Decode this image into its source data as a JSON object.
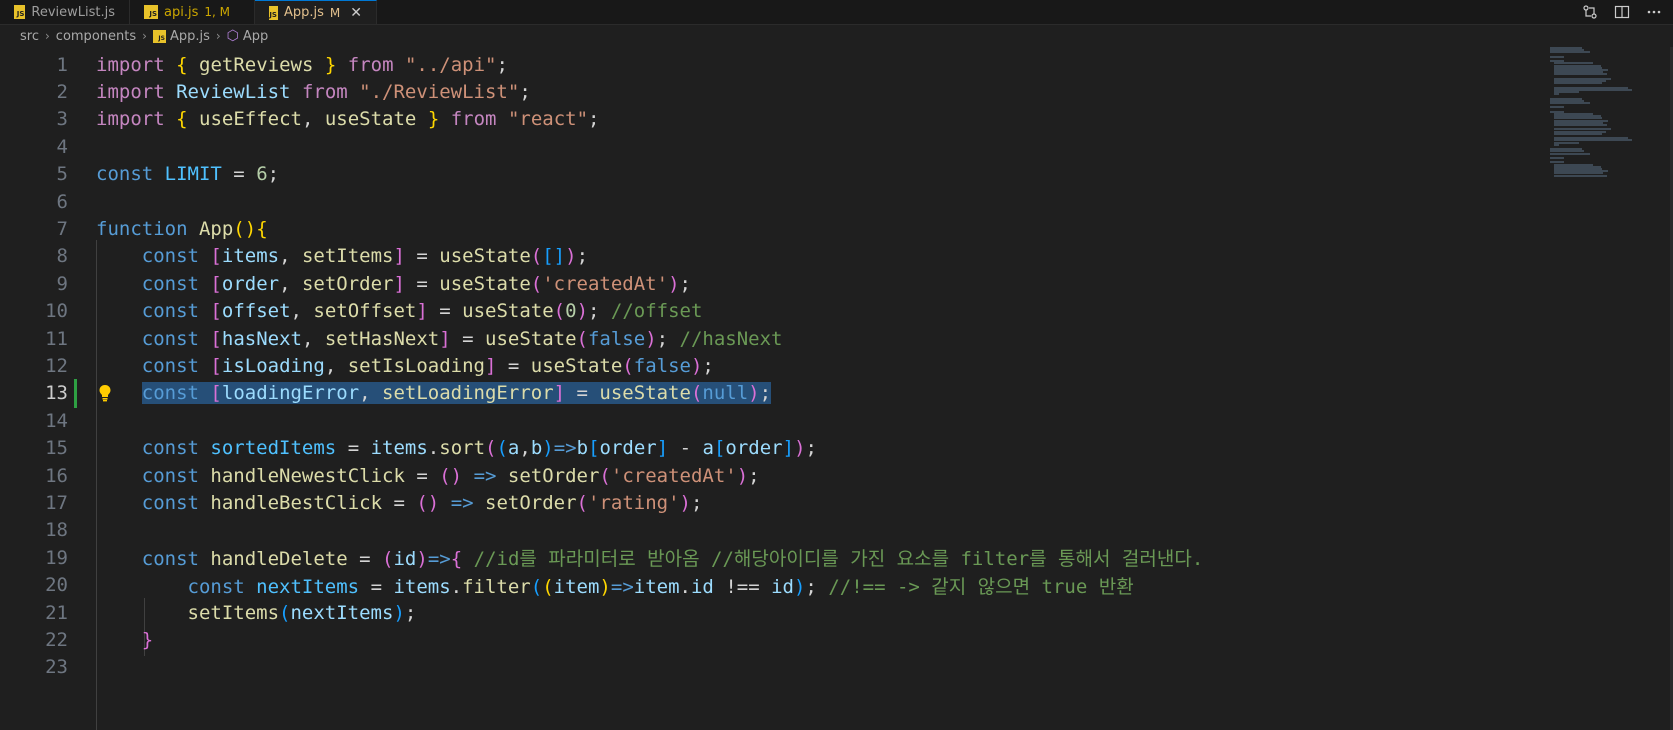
{
  "tabs": [
    {
      "label": "ReviewList.js",
      "status": "",
      "active": false
    },
    {
      "label": "api.js",
      "status": "1, M",
      "active": false
    },
    {
      "label": "App.js",
      "status": "M",
      "active": true
    }
  ],
  "breadcrumb": {
    "folder1": "src",
    "folder2": "components",
    "file": "App.js",
    "symbol": "App"
  },
  "editor": {
    "current_line": 13,
    "line_numbers": [
      "1",
      "2",
      "3",
      "4",
      "5",
      "6",
      "7",
      "8",
      "9",
      "10",
      "11",
      "12",
      "13",
      "14",
      "15",
      "16",
      "17",
      "18",
      "19",
      "20",
      "21",
      "22",
      "23"
    ],
    "lines": [
      [
        [
          "kw",
          "import"
        ],
        [
          "p",
          " "
        ],
        [
          "b1",
          "{"
        ],
        [
          "p",
          " "
        ],
        [
          "fn",
          "getReviews"
        ],
        [
          "p",
          " "
        ],
        [
          "b1",
          "}"
        ],
        [
          "p",
          " "
        ],
        [
          "kw",
          "from"
        ],
        [
          "p",
          " "
        ],
        [
          "s",
          "\"../api\""
        ],
        [
          "p",
          ";"
        ]
      ],
      [
        [
          "kw",
          "import"
        ],
        [
          "p",
          " "
        ],
        [
          "v",
          "ReviewList"
        ],
        [
          "p",
          " "
        ],
        [
          "kw",
          "from"
        ],
        [
          "p",
          " "
        ],
        [
          "s",
          "\"./ReviewList\""
        ],
        [
          "p",
          ";"
        ]
      ],
      [
        [
          "kw",
          "import"
        ],
        [
          "p",
          " "
        ],
        [
          "b1",
          "{"
        ],
        [
          "p",
          " "
        ],
        [
          "fn",
          "useEffect"
        ],
        [
          "p",
          ", "
        ],
        [
          "fn",
          "useState"
        ],
        [
          "p",
          " "
        ],
        [
          "b1",
          "}"
        ],
        [
          "p",
          " "
        ],
        [
          "kw",
          "from"
        ],
        [
          "p",
          " "
        ],
        [
          "s",
          "\"react\""
        ],
        [
          "p",
          ";"
        ]
      ],
      [],
      [
        [
          "dc",
          "const"
        ],
        [
          "p",
          " "
        ],
        [
          "cn",
          "LIMIT"
        ],
        [
          "p",
          " = "
        ],
        [
          "n",
          "6"
        ],
        [
          "p",
          ";"
        ]
      ],
      [],
      [
        [
          "dc",
          "function"
        ],
        [
          "p",
          " "
        ],
        [
          "fn",
          "App"
        ],
        [
          "b1",
          "()"
        ],
        [
          "b1",
          "{"
        ]
      ],
      [
        [
          "p",
          "    "
        ],
        [
          "dc",
          "const"
        ],
        [
          "p",
          " "
        ],
        [
          "b2",
          "["
        ],
        [
          "v",
          "items"
        ],
        [
          "p",
          ", "
        ],
        [
          "fn",
          "setItems"
        ],
        [
          "b2",
          "]"
        ],
        [
          "p",
          " = "
        ],
        [
          "fn",
          "useState"
        ],
        [
          "b2",
          "("
        ],
        [
          "b3",
          "[]"
        ],
        [
          "b2",
          ")"
        ],
        [
          "p",
          ";"
        ]
      ],
      [
        [
          "p",
          "    "
        ],
        [
          "dc",
          "const"
        ],
        [
          "p",
          " "
        ],
        [
          "b2",
          "["
        ],
        [
          "v",
          "order"
        ],
        [
          "p",
          ", "
        ],
        [
          "fn",
          "setOrder"
        ],
        [
          "b2",
          "]"
        ],
        [
          "p",
          " = "
        ],
        [
          "fn",
          "useState"
        ],
        [
          "b2",
          "("
        ],
        [
          "s",
          "'createdAt'"
        ],
        [
          "b2",
          ")"
        ],
        [
          "p",
          ";"
        ]
      ],
      [
        [
          "p",
          "    "
        ],
        [
          "dc",
          "const"
        ],
        [
          "p",
          " "
        ],
        [
          "b2",
          "["
        ],
        [
          "v",
          "offset"
        ],
        [
          "p",
          ", "
        ],
        [
          "fn",
          "setOffset"
        ],
        [
          "b2",
          "]"
        ],
        [
          "p",
          " = "
        ],
        [
          "fn",
          "useState"
        ],
        [
          "b2",
          "("
        ],
        [
          "n",
          "0"
        ],
        [
          "b2",
          ")"
        ],
        [
          "p",
          "; "
        ],
        [
          "c",
          "//offset"
        ]
      ],
      [
        [
          "p",
          "    "
        ],
        [
          "dc",
          "const"
        ],
        [
          "p",
          " "
        ],
        [
          "b2",
          "["
        ],
        [
          "v",
          "hasNext"
        ],
        [
          "p",
          ", "
        ],
        [
          "fn",
          "setHasNext"
        ],
        [
          "b2",
          "]"
        ],
        [
          "p",
          " = "
        ],
        [
          "fn",
          "useState"
        ],
        [
          "b2",
          "("
        ],
        [
          "dc",
          "false"
        ],
        [
          "b2",
          ")"
        ],
        [
          "p",
          "; "
        ],
        [
          "c",
          "//hasNext"
        ]
      ],
      [
        [
          "p",
          "    "
        ],
        [
          "dc",
          "const"
        ],
        [
          "p",
          " "
        ],
        [
          "b2",
          "["
        ],
        [
          "v",
          "isLoading"
        ],
        [
          "p",
          ", "
        ],
        [
          "fn",
          "setIsLoading"
        ],
        [
          "b2",
          "]"
        ],
        [
          "p",
          " = "
        ],
        [
          "fn",
          "useState"
        ],
        [
          "b2",
          "("
        ],
        [
          "dc",
          "false"
        ],
        [
          "b2",
          ")"
        ],
        [
          "p",
          ";"
        ]
      ],
      [
        [
          "p",
          "    "
        ],
        [
          "dc",
          "const"
        ],
        [
          "p",
          " "
        ],
        [
          "b2",
          "["
        ],
        [
          "v",
          "loadingError"
        ],
        [
          "p",
          ", "
        ],
        [
          "fn",
          "setLoadingError"
        ],
        [
          "b2",
          "]"
        ],
        [
          "p",
          " = "
        ],
        [
          "fn",
          "useState"
        ],
        [
          "b2",
          "("
        ],
        [
          "dc",
          "null"
        ],
        [
          "b2",
          ")"
        ],
        [
          "p",
          ";"
        ]
      ],
      [],
      [
        [
          "p",
          "    "
        ],
        [
          "dc",
          "const"
        ],
        [
          "p",
          " "
        ],
        [
          "cn",
          "sortedItems"
        ],
        [
          "p",
          " = "
        ],
        [
          "v",
          "items"
        ],
        [
          "p",
          "."
        ],
        [
          "fn",
          "sort"
        ],
        [
          "b2",
          "("
        ],
        [
          "b3",
          "("
        ],
        [
          "v",
          "a"
        ],
        [
          "p",
          ","
        ],
        [
          "v",
          "b"
        ],
        [
          "b3",
          ")"
        ],
        [
          "dc",
          "=>"
        ],
        [
          "v",
          "b"
        ],
        [
          "b3",
          "["
        ],
        [
          "v",
          "order"
        ],
        [
          "b3",
          "]"
        ],
        [
          "p",
          " - "
        ],
        [
          "v",
          "a"
        ],
        [
          "b3",
          "["
        ],
        [
          "v",
          "order"
        ],
        [
          "b3",
          "]"
        ],
        [
          "b2",
          ")"
        ],
        [
          "p",
          ";"
        ]
      ],
      [
        [
          "p",
          "    "
        ],
        [
          "dc",
          "const"
        ],
        [
          "p",
          " "
        ],
        [
          "fn",
          "handleNewestClick"
        ],
        [
          "p",
          " = "
        ],
        [
          "b2",
          "()"
        ],
        [
          "p",
          " "
        ],
        [
          "dc",
          "=>"
        ],
        [
          "p",
          " "
        ],
        [
          "fn",
          "setOrder"
        ],
        [
          "b2",
          "("
        ],
        [
          "s",
          "'createdAt'"
        ],
        [
          "b2",
          ")"
        ],
        [
          "p",
          ";"
        ]
      ],
      [
        [
          "p",
          "    "
        ],
        [
          "dc",
          "const"
        ],
        [
          "p",
          " "
        ],
        [
          "fn",
          "handleBestClick"
        ],
        [
          "p",
          " = "
        ],
        [
          "b2",
          "()"
        ],
        [
          "p",
          " "
        ],
        [
          "dc",
          "=>"
        ],
        [
          "p",
          " "
        ],
        [
          "fn",
          "setOrder"
        ],
        [
          "b2",
          "("
        ],
        [
          "s",
          "'rating'"
        ],
        [
          "b2",
          ")"
        ],
        [
          "p",
          ";"
        ]
      ],
      [],
      [
        [
          "p",
          "    "
        ],
        [
          "dc",
          "const"
        ],
        [
          "p",
          " "
        ],
        [
          "fn",
          "handleDelete"
        ],
        [
          "p",
          " = "
        ],
        [
          "b2",
          "("
        ],
        [
          "v",
          "id"
        ],
        [
          "b2",
          ")"
        ],
        [
          "dc",
          "=>"
        ],
        [
          "b2",
          "{"
        ],
        [
          "p",
          " "
        ],
        [
          "c",
          "//id를 파라미터로 받아옴 //해당아이디를 가진 요소를 filter를 통해서 걸러낸다."
        ]
      ],
      [
        [
          "p",
          "        "
        ],
        [
          "dc",
          "const"
        ],
        [
          "p",
          " "
        ],
        [
          "cn",
          "nextItems"
        ],
        [
          "p",
          " = "
        ],
        [
          "v",
          "items"
        ],
        [
          "p",
          "."
        ],
        [
          "fn",
          "filter"
        ],
        [
          "b3",
          "("
        ],
        [
          "b1",
          "("
        ],
        [
          "v",
          "item"
        ],
        [
          "b1",
          ")"
        ],
        [
          "dc",
          "=>"
        ],
        [
          "v",
          "item"
        ],
        [
          "p",
          "."
        ],
        [
          "v",
          "id"
        ],
        [
          "p",
          " !== "
        ],
        [
          "v",
          "id"
        ],
        [
          "b3",
          ")"
        ],
        [
          "p",
          "; "
        ],
        [
          "c",
          "//!== -> 같지 않으면 true 반환"
        ]
      ],
      [
        [
          "p",
          "        "
        ],
        [
          "fn",
          "setItems"
        ],
        [
          "b3",
          "("
        ],
        [
          "v",
          "nextItems"
        ],
        [
          "b3",
          ")"
        ],
        [
          "p",
          ";"
        ]
      ],
      [
        [
          "p",
          "    "
        ],
        [
          "b2",
          "}"
        ]
      ],
      []
    ]
  }
}
